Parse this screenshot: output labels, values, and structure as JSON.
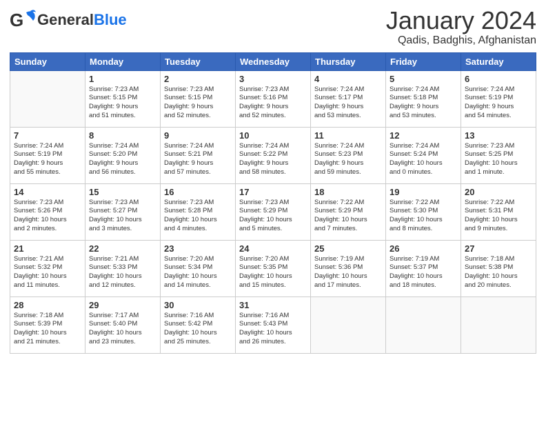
{
  "header": {
    "logo_general": "General",
    "logo_blue": "Blue",
    "month_title": "January 2024",
    "location": "Qadis, Badghis, Afghanistan"
  },
  "days_of_week": [
    "Sunday",
    "Monday",
    "Tuesday",
    "Wednesday",
    "Thursday",
    "Friday",
    "Saturday"
  ],
  "weeks": [
    [
      {
        "day": "",
        "info": ""
      },
      {
        "day": "1",
        "info": "Sunrise: 7:23 AM\nSunset: 5:15 PM\nDaylight: 9 hours\nand 51 minutes."
      },
      {
        "day": "2",
        "info": "Sunrise: 7:23 AM\nSunset: 5:15 PM\nDaylight: 9 hours\nand 52 minutes."
      },
      {
        "day": "3",
        "info": "Sunrise: 7:23 AM\nSunset: 5:16 PM\nDaylight: 9 hours\nand 52 minutes."
      },
      {
        "day": "4",
        "info": "Sunrise: 7:24 AM\nSunset: 5:17 PM\nDaylight: 9 hours\nand 53 minutes."
      },
      {
        "day": "5",
        "info": "Sunrise: 7:24 AM\nSunset: 5:18 PM\nDaylight: 9 hours\nand 53 minutes."
      },
      {
        "day": "6",
        "info": "Sunrise: 7:24 AM\nSunset: 5:19 PM\nDaylight: 9 hours\nand 54 minutes."
      }
    ],
    [
      {
        "day": "7",
        "info": "Sunrise: 7:24 AM\nSunset: 5:19 PM\nDaylight: 9 hours\nand 55 minutes."
      },
      {
        "day": "8",
        "info": "Sunrise: 7:24 AM\nSunset: 5:20 PM\nDaylight: 9 hours\nand 56 minutes."
      },
      {
        "day": "9",
        "info": "Sunrise: 7:24 AM\nSunset: 5:21 PM\nDaylight: 9 hours\nand 57 minutes."
      },
      {
        "day": "10",
        "info": "Sunrise: 7:24 AM\nSunset: 5:22 PM\nDaylight: 9 hours\nand 58 minutes."
      },
      {
        "day": "11",
        "info": "Sunrise: 7:24 AM\nSunset: 5:23 PM\nDaylight: 9 hours\nand 59 minutes."
      },
      {
        "day": "12",
        "info": "Sunrise: 7:24 AM\nSunset: 5:24 PM\nDaylight: 10 hours\nand 0 minutes."
      },
      {
        "day": "13",
        "info": "Sunrise: 7:23 AM\nSunset: 5:25 PM\nDaylight: 10 hours\nand 1 minute."
      }
    ],
    [
      {
        "day": "14",
        "info": "Sunrise: 7:23 AM\nSunset: 5:26 PM\nDaylight: 10 hours\nand 2 minutes."
      },
      {
        "day": "15",
        "info": "Sunrise: 7:23 AM\nSunset: 5:27 PM\nDaylight: 10 hours\nand 3 minutes."
      },
      {
        "day": "16",
        "info": "Sunrise: 7:23 AM\nSunset: 5:28 PM\nDaylight: 10 hours\nand 4 minutes."
      },
      {
        "day": "17",
        "info": "Sunrise: 7:23 AM\nSunset: 5:29 PM\nDaylight: 10 hours\nand 5 minutes."
      },
      {
        "day": "18",
        "info": "Sunrise: 7:22 AM\nSunset: 5:29 PM\nDaylight: 10 hours\nand 7 minutes."
      },
      {
        "day": "19",
        "info": "Sunrise: 7:22 AM\nSunset: 5:30 PM\nDaylight: 10 hours\nand 8 minutes."
      },
      {
        "day": "20",
        "info": "Sunrise: 7:22 AM\nSunset: 5:31 PM\nDaylight: 10 hours\nand 9 minutes."
      }
    ],
    [
      {
        "day": "21",
        "info": "Sunrise: 7:21 AM\nSunset: 5:32 PM\nDaylight: 10 hours\nand 11 minutes."
      },
      {
        "day": "22",
        "info": "Sunrise: 7:21 AM\nSunset: 5:33 PM\nDaylight: 10 hours\nand 12 minutes."
      },
      {
        "day": "23",
        "info": "Sunrise: 7:20 AM\nSunset: 5:34 PM\nDaylight: 10 hours\nand 14 minutes."
      },
      {
        "day": "24",
        "info": "Sunrise: 7:20 AM\nSunset: 5:35 PM\nDaylight: 10 hours\nand 15 minutes."
      },
      {
        "day": "25",
        "info": "Sunrise: 7:19 AM\nSunset: 5:36 PM\nDaylight: 10 hours\nand 17 minutes."
      },
      {
        "day": "26",
        "info": "Sunrise: 7:19 AM\nSunset: 5:37 PM\nDaylight: 10 hours\nand 18 minutes."
      },
      {
        "day": "27",
        "info": "Sunrise: 7:18 AM\nSunset: 5:38 PM\nDaylight: 10 hours\nand 20 minutes."
      }
    ],
    [
      {
        "day": "28",
        "info": "Sunrise: 7:18 AM\nSunset: 5:39 PM\nDaylight: 10 hours\nand 21 minutes."
      },
      {
        "day": "29",
        "info": "Sunrise: 7:17 AM\nSunset: 5:40 PM\nDaylight: 10 hours\nand 23 minutes."
      },
      {
        "day": "30",
        "info": "Sunrise: 7:16 AM\nSunset: 5:42 PM\nDaylight: 10 hours\nand 25 minutes."
      },
      {
        "day": "31",
        "info": "Sunrise: 7:16 AM\nSunset: 5:43 PM\nDaylight: 10 hours\nand 26 minutes."
      },
      {
        "day": "",
        "info": ""
      },
      {
        "day": "",
        "info": ""
      },
      {
        "day": "",
        "info": ""
      }
    ]
  ]
}
